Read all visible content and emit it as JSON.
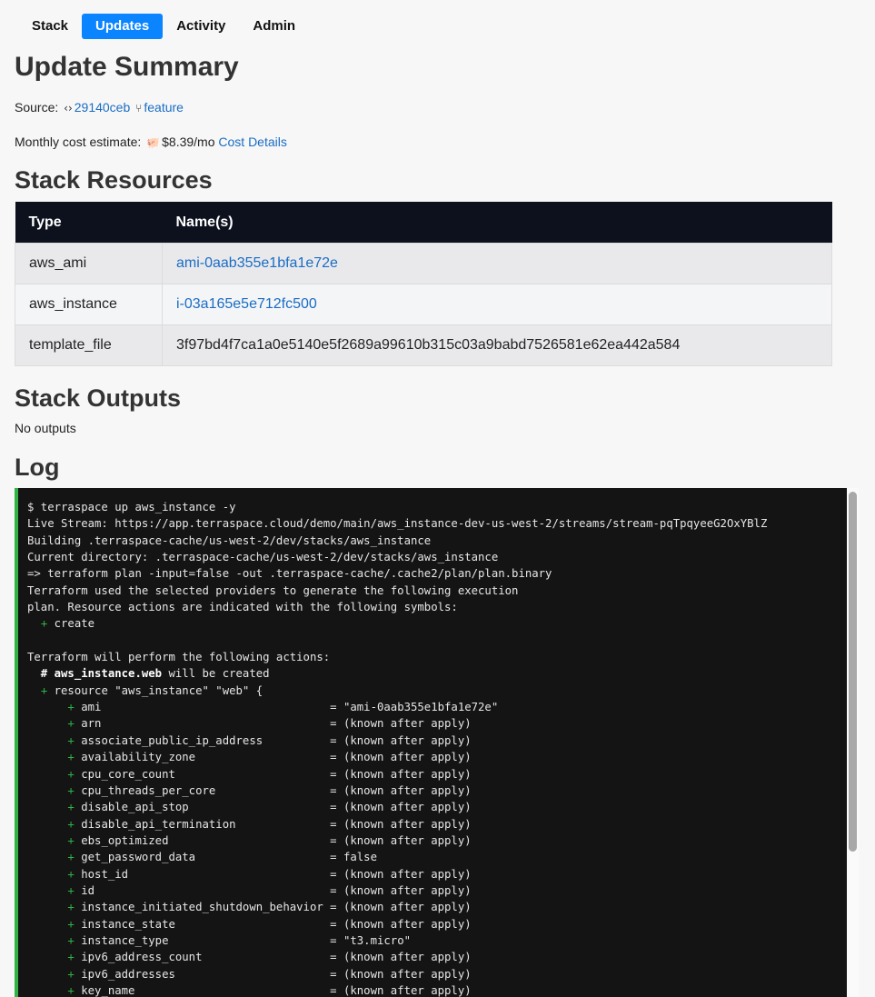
{
  "nav": {
    "items": [
      {
        "label": "Stack",
        "active": false
      },
      {
        "label": "Updates",
        "active": true
      },
      {
        "label": "Activity",
        "active": false
      },
      {
        "label": "Admin",
        "active": false
      }
    ]
  },
  "summary": {
    "title": "Update Summary",
    "source_label": "Source:",
    "commit": "29140ceb",
    "branch": "feature",
    "cost_label": "Monthly cost estimate:",
    "cost_value": "$8.39/mo",
    "cost_link": "Cost Details"
  },
  "resources": {
    "title": "Stack Resources",
    "headers": [
      "Type",
      "Name(s)"
    ],
    "rows": [
      {
        "type": "aws_ami",
        "name": "ami-0aab355e1bfa1e72e",
        "link": true
      },
      {
        "type": "aws_instance",
        "name": "i-03a165e5e712fc500",
        "link": true
      },
      {
        "type": "template_file",
        "name": "3f97bd4f7ca1a0e5140e5f2689a99610b315c03a9babd7526581e62ea442a584",
        "link": false
      }
    ]
  },
  "outputs": {
    "title": "Stack Outputs",
    "empty_text": "No outputs"
  },
  "log": {
    "title": "Log",
    "lines": [
      "$ terraspace up aws_instance -y",
      "Live Stream: https://app.terraspace.cloud/demo/main/aws_instance-dev-us-west-2/streams/stream-pqTpqyeeG2OxYBlZ",
      "Building .terraspace-cache/us-west-2/dev/stacks/aws_instance",
      "Current directory: .terraspace-cache/us-west-2/dev/stacks/aws_instance",
      "=> terraform plan -input=false -out .terraspace-cache/.cache2/plan/plan.binary",
      "Terraform used the selected providers to generate the following execution",
      "plan. Resource actions are indicated with the following symbols:",
      "  + create",
      "",
      "Terraform will perform the following actions:",
      "  # aws_instance.web will be created",
      "  + resource \"aws_instance\" \"web\" {",
      "      + ami                                  = \"ami-0aab355e1bfa1e72e\"",
      "      + arn                                  = (known after apply)",
      "      + associate_public_ip_address          = (known after apply)",
      "      + availability_zone                    = (known after apply)",
      "      + cpu_core_count                       = (known after apply)",
      "      + cpu_threads_per_core                 = (known after apply)",
      "      + disable_api_stop                     = (known after apply)",
      "      + disable_api_termination              = (known after apply)",
      "      + ebs_optimized                        = (known after apply)",
      "      + get_password_data                    = false",
      "      + host_id                              = (known after apply)",
      "      + id                                   = (known after apply)",
      "      + instance_initiated_shutdown_behavior = (known after apply)",
      "      + instance_state                       = (known after apply)",
      "      + instance_type                        = \"t3.micro\"",
      "      + ipv6_address_count                   = (known after apply)",
      "      + ipv6_addresses                       = (known after apply)",
      "      + key_name                             = (known after apply)"
    ]
  },
  "icons": {
    "code": "code-icon",
    "branch": "branch-icon",
    "piggy": "piggy-bank-icon"
  },
  "colors": {
    "accent": "#0a84ff",
    "link": "#1a6dc4",
    "table_header": "#0c111d",
    "log_bg": "#141414",
    "log_border": "#2fb344"
  }
}
